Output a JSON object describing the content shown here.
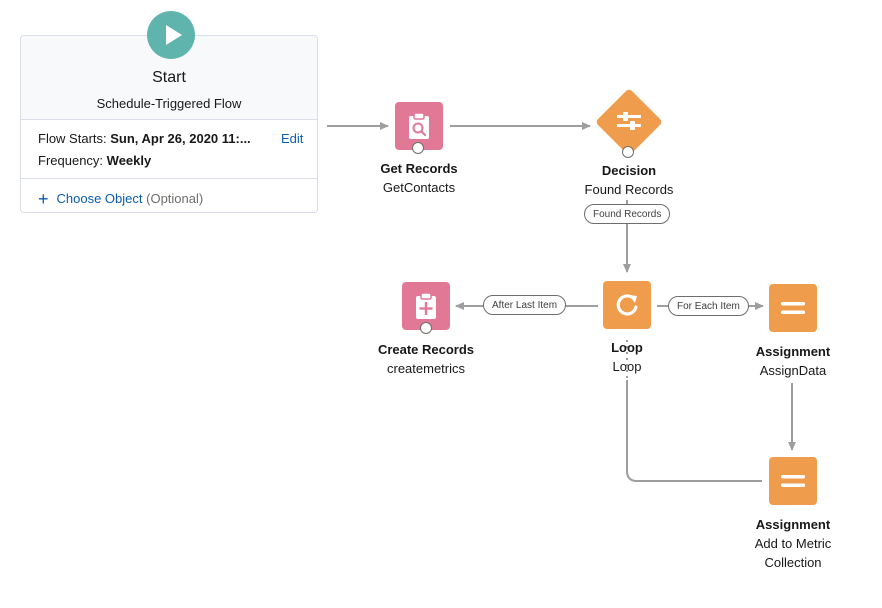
{
  "start": {
    "title": "Start",
    "type": "Schedule-Triggered Flow",
    "flow_starts_label": "Flow Starts:",
    "flow_starts_value": "Sun, Apr 26, 2020 11:...",
    "edit_label": "Edit",
    "frequency_label": "Frequency:",
    "frequency_value": "Weekly",
    "choose_object_label": "Choose Object",
    "optional_label": "(Optional)",
    "icon": "play-icon"
  },
  "nodes": {
    "get_records": {
      "type": "Get Records",
      "name": "GetContacts",
      "icon": "search-record-icon"
    },
    "decision": {
      "type": "Decision",
      "name": "Found Records",
      "icon": "decision-icon"
    },
    "loop": {
      "type": "Loop",
      "name": "Loop",
      "icon": "loop-icon"
    },
    "create_records": {
      "type": "Create Records",
      "name": "createmetrics",
      "icon": "create-record-icon"
    },
    "assignment1": {
      "type": "Assignment",
      "name": "AssignData",
      "icon": "assignment-icon"
    },
    "assignment2": {
      "type": "Assignment",
      "name": "Add to Metric Collection",
      "icon": "assignment-icon"
    }
  },
  "edges": {
    "found_records": "Found Records",
    "after_last_item": "After Last Item",
    "for_each_item": "For Each Item"
  },
  "colors": {
    "start": "#5fb4ae",
    "record": "#e07896",
    "logic": "#ef9c4c",
    "link": "#0b5cab",
    "connector": "#9e9e9e"
  }
}
